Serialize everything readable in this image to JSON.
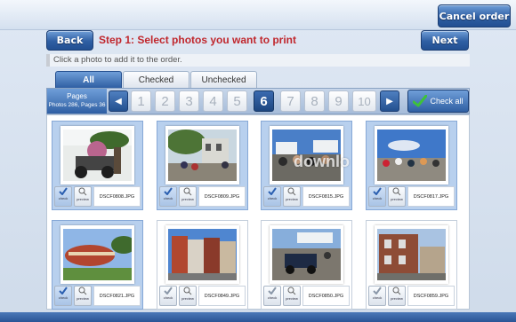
{
  "header": {
    "cancel_label": "Cancel order",
    "back_label": "Back",
    "next_label": "Next",
    "step_title": "Step 1: Select photos you want to print",
    "hint": "Click a photo to add it to the order."
  },
  "tabs": [
    {
      "label": "All",
      "active": true
    },
    {
      "label": "Checked",
      "active": false
    },
    {
      "label": "Unchecked",
      "active": false
    }
  ],
  "pagination": {
    "label": "Pages",
    "summary": "Photos 286, Pages 36",
    "pages": [
      "1",
      "2",
      "3",
      "4",
      "5",
      "6",
      "7",
      "8",
      "9",
      "10"
    ],
    "current": "6",
    "prev_icon": "left-arrow-icon",
    "next_icon": "right-arrow-icon",
    "check_all_label": "Check all"
  },
  "card_controls": {
    "check_label": "check",
    "preview_label": "preview"
  },
  "photos": [
    {
      "file": "DSCF0808.JPG",
      "checked": true
    },
    {
      "file": "DSCF0809.JPG",
      "checked": true
    },
    {
      "file": "DSCF0815.JPG",
      "checked": true
    },
    {
      "file": "DSCF0817.JPG",
      "checked": true
    },
    {
      "file": "DSCF0821.JPG",
      "checked": true
    },
    {
      "file": "DSCF0849.JPG",
      "checked": false
    },
    {
      "file": "DSCF0850.JPG",
      "checked": false
    },
    {
      "file": "DSCF0859.JPG",
      "checked": false
    }
  ],
  "watermark": "downlo",
  "colors": {
    "accent": "#2f5fa3",
    "title": "#c0272d",
    "selected_card": "#b8d0ee"
  }
}
